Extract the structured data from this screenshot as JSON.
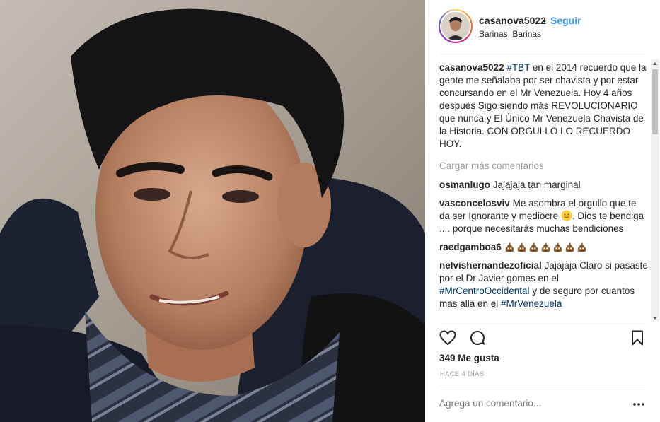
{
  "post": {
    "username": "casanova5022",
    "separator": "•",
    "follow_label": "Seguir",
    "location": "Barinas, Barinas"
  },
  "caption": {
    "username": "casanova5022",
    "hashtag": "#TBT",
    "text": " en el 2014 recuerdo que la gente me señalaba por ser chavista y por estar concursando en el Mr Venezuela. Hoy 4 años después Sigo siendo más REVOLUCIONARIO que nunca y El Único Mr Venezuela Chavista de la Historia. CON ORGULLO LO RECUERDO HOY."
  },
  "load_more_label": "Cargar más comentarios",
  "comments": [
    {
      "username": "osmanlugo",
      "text": "Jajajaja tan marginal"
    },
    {
      "username": "vasconcelosviv",
      "text_before": "Me asombra el orgullo que te da ser Ignorante y mediocre ",
      "emoji": "slightly-smiling-face",
      "text_after": ". Dios te bendiga .... porque necesitarás muchas bendiciones"
    },
    {
      "username": "raedgamboa6",
      "emoji": "pile-of-poo",
      "emoji_count": 7
    },
    {
      "username": "nelvishernandezoficial",
      "text_1": "Jajajaja Claro si pasaste por el Dr Javier gomes en el ",
      "tag_1": "#MrCentroOccidental",
      "text_2": " y de seguro por cuantos mas alla en el ",
      "tag_2": "#MrVenezuela"
    }
  ],
  "actions": {
    "like_icon": "heart-icon",
    "comment_icon": "comment-icon",
    "save_icon": "bookmark-icon"
  },
  "likes_label": "349 Me gusta",
  "timestamp": "HACE 4 DÍAS",
  "add_comment": {
    "placeholder": "Agrega un comentario...",
    "more_icon": "more-options-icon"
  },
  "colors": {
    "link": "#3897f0",
    "hashtag": "#003569",
    "muted": "#999999",
    "text": "#262626"
  }
}
